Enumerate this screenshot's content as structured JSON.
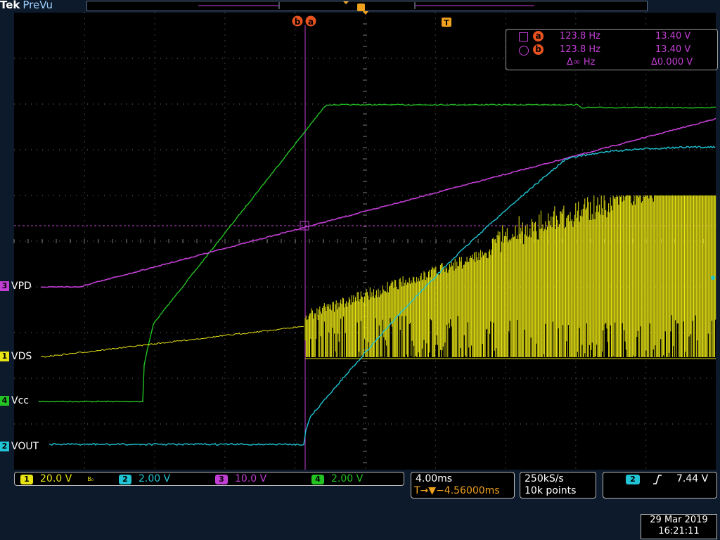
{
  "header": {
    "brand": "Tek",
    "mode": "PreVu"
  },
  "channels": [
    {
      "num": "3",
      "name": "VPD",
      "color": "#c23fd4"
    },
    {
      "num": "1",
      "name": "VDS",
      "color": "#e8e414"
    },
    {
      "num": "4",
      "name": "Vcc",
      "color": "#22c322"
    },
    {
      "num": "2",
      "name": "VOUT",
      "color": "#20c4d4"
    }
  ],
  "cursor_labels": {
    "b": "b",
    "a": "a",
    "trigger": "T"
  },
  "measurements": {
    "row_a": {
      "label": "a",
      "freq": "123.8 Hz",
      "volt": "13.40 V"
    },
    "row_b": {
      "label": "b",
      "freq": "123.8 Hz",
      "volt": "13.40 V"
    },
    "delta": {
      "freq": "Δ∞ Hz",
      "volt": "Δ0.000 V"
    }
  },
  "scales": [
    {
      "num": "1",
      "value": "20.0 V",
      "color": "#e8e414",
      "bw": "B₀"
    },
    {
      "num": "2",
      "value": "2.00 V",
      "color": "#20c4d4"
    },
    {
      "num": "3",
      "value": "10.0 V",
      "color": "#c23fd4"
    },
    {
      "num": "4",
      "value": "2.00 V",
      "color": "#22c322"
    }
  ],
  "timebase": {
    "div": "4.00ms",
    "position": "−4.56000ms",
    "pos_icon": "T→▼"
  },
  "acquisition": {
    "rate": "250kS/s",
    "points": "10k points"
  },
  "trigger": {
    "channel": "2",
    "slope_icon": "rising-edge-icon",
    "level": "7.44 V"
  },
  "datetime": {
    "date": "29 Mar  2019",
    "time": "16:21:11"
  }
}
